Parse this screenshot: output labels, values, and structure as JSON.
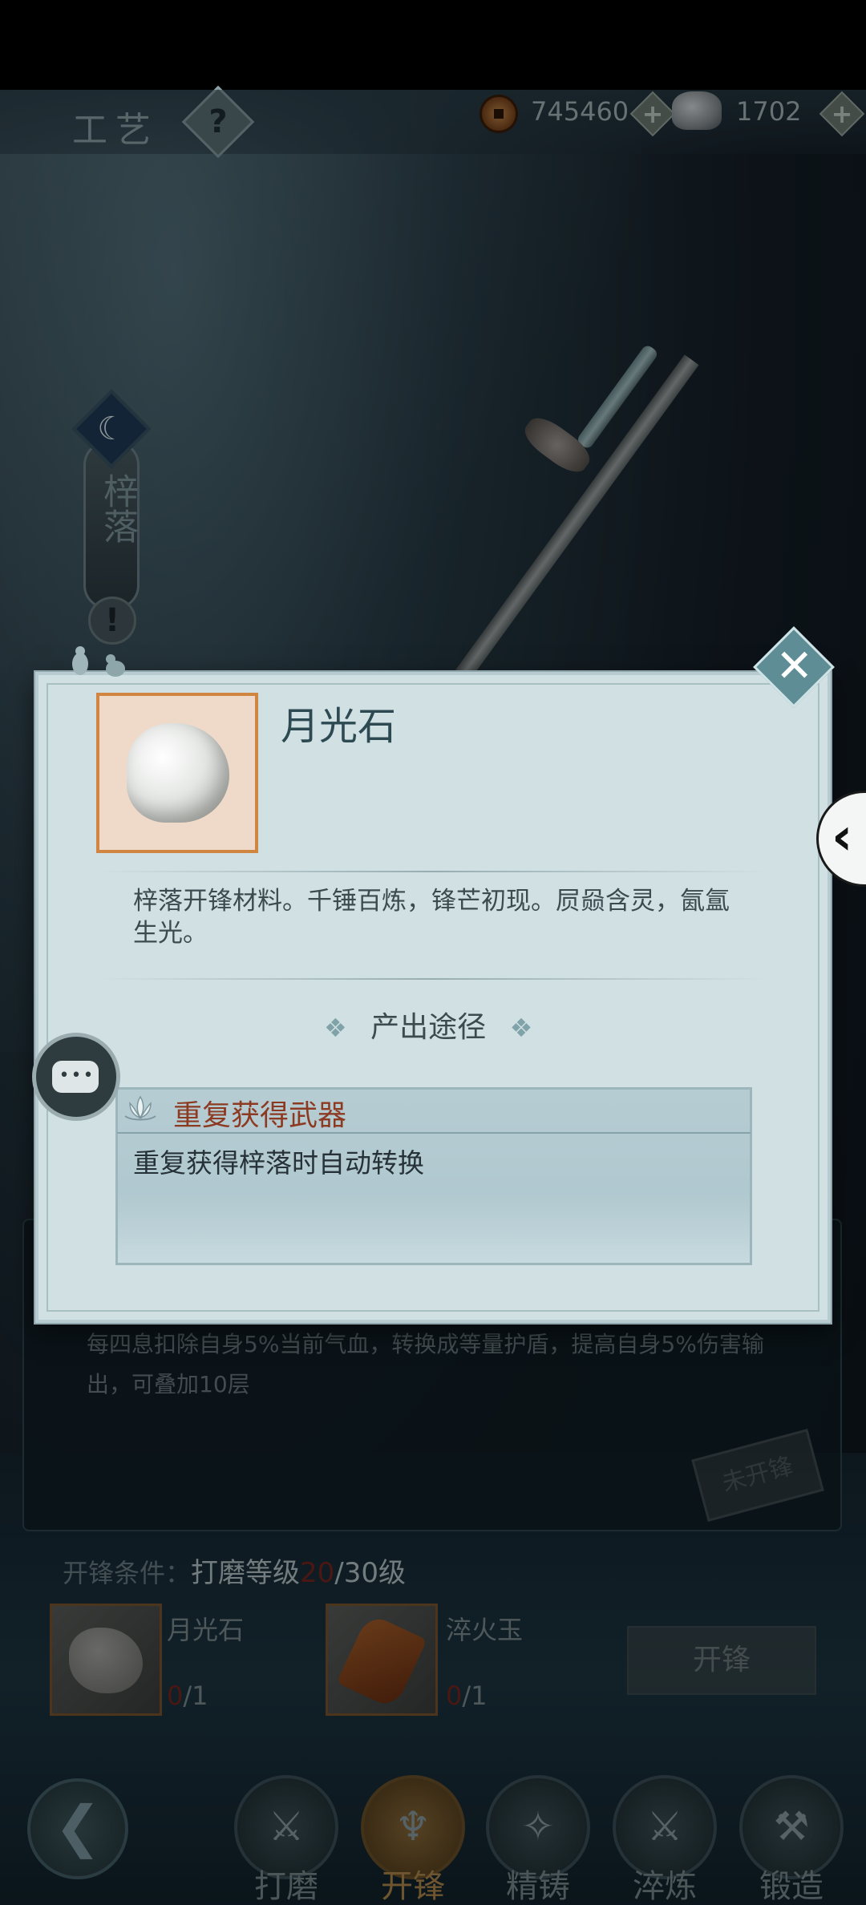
{
  "top_bar": {
    "title": "工艺",
    "help_icon": "question-icon",
    "copper_value": "745460",
    "silver_value": "1702"
  },
  "side_tag": {
    "label": "梓落"
  },
  "modal": {
    "item_name": "月光石",
    "item_description": "梓落开锋材料。千锤百炼，锋芒初现。屃赑含灵，氤氲生光。",
    "source_section_title": "产出途径",
    "source_card": {
      "title": "重复获得武器",
      "description": "重复获得梓落时自动转换"
    }
  },
  "background": {
    "effect_text": "每四息扣除自身5%当前气血，转换成等量护盾，提高自身5%伤害输出，可叠加10层",
    "stamp_text": "未开锋",
    "condition_label": "开锋条件：",
    "condition_requirement": "打磨等级",
    "condition_current": "20",
    "condition_target": "/30级",
    "materials": [
      {
        "name": "月光石",
        "current": "0",
        "required": "/1"
      },
      {
        "name": "淬火玉",
        "current": "0",
        "required": "/1"
      }
    ],
    "open_button": "开锋"
  },
  "bottom_nav": [
    {
      "label": "打磨",
      "icon": "grind-icon",
      "active": false
    },
    {
      "label": "开锋",
      "icon": "edge-icon",
      "active": true
    },
    {
      "label": "精铸",
      "icon": "cast-icon",
      "active": false
    },
    {
      "label": "淬炼",
      "icon": "temper-icon",
      "active": false
    },
    {
      "label": "锻造",
      "icon": "forge-icon",
      "active": false
    }
  ],
  "colors": {
    "accent_red": "#8d3a22",
    "modal_bg": "#d1e0e3",
    "active_nav": "#b48a4c"
  }
}
